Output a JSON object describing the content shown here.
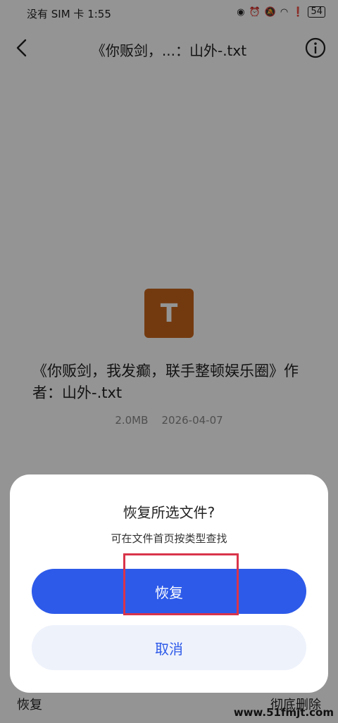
{
  "status": {
    "time": "没有 SIM 卡 1:55",
    "icons": [
      "eye-icon",
      "alarm-icon",
      "mute-icon",
      "wifi-icon",
      "alert-icon"
    ],
    "battery": "54"
  },
  "header": {
    "title": "《你贩剑，...：山外-.txt"
  },
  "file": {
    "icon_letter": "T",
    "name": "《你贩剑，我发癫，联手整顿娱乐圈》作者：山外-.txt",
    "size": "2.0MB",
    "date": "2026-04-07",
    "icon_color": "#c8651b"
  },
  "bottom_bar": {
    "restore_label": "恢复",
    "delete_label": "彻底删除"
  },
  "dialog": {
    "title": "恢复所选文件?",
    "subtitle": "可在文件首页按类型查找",
    "confirm_label": "恢复",
    "cancel_label": "取消",
    "accent": "#2d5ae9"
  },
  "watermark": "www.51fmjt.com"
}
